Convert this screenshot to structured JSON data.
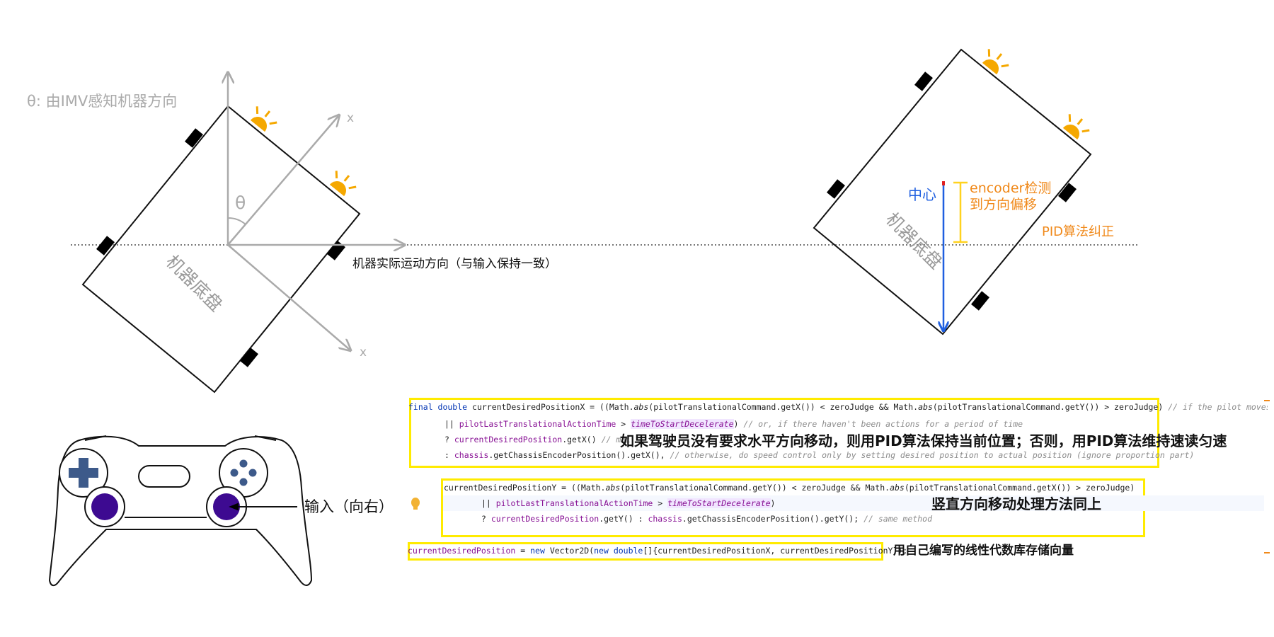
{
  "left_diagram": {
    "theta_caption": "θ: 由IMV感知机器方向",
    "axis_x_upper": "x",
    "axis_x_lower": "x",
    "theta_symbol": "θ",
    "chassis_label": "机器底盘",
    "motion_label": "机器实际运动方向（与输入保持一致）"
  },
  "right_diagram": {
    "chassis_label": "机器底盘",
    "center_label": "中心",
    "encoder_label_line1": "encoder检测",
    "encoder_label_line2": "到方向偏移",
    "pid_label": "PID算法纠正"
  },
  "gamepad": {
    "input_label": "输入（向右）"
  },
  "code": {
    "block_x": {
      "line1_a": "final double ",
      "line1_b": "currentDesiredPositionX = ((Math.",
      "line1_c": "abs",
      "line1_d": "(pilotTranslationalCommand.getX()) < zeroJudge && Math.",
      "line1_e": "abs",
      "line1_f": "(pilotTranslationalCommand.getY()) > zeroJudge) ",
      "line1_g": "// if the pilot moves the y axi",
      "line2_a": "|| ",
      "line2_b": "pilotLastTranslationalActionTime",
      "line2_c": " > ",
      "line2_d": "timeToStartDecelerate",
      "line2_e": ") ",
      "line2_f": "// or, if there haven't been actions for a period of time",
      "line3_a": "? ",
      "line3_b": "currentDesiredPosition",
      "line3_c": ".getX() ",
      "line3_d": "// mai",
      "line4_a": ": ",
      "line4_b": "chassis",
      "line4_c": ".getChassisEncoderPosition().getX(), ",
      "line4_d": "// otherwise, do speed control only by setting desired position to actual position (ignore proportion part)"
    },
    "block_y": {
      "line1_a": "currentDesiredPositionY = ((Math.",
      "line1_b": "abs",
      "line1_c": "(pilotTranslationalCommand.getY()) < zeroJudge && Math.",
      "line1_d": "abs",
      "line1_e": "(pilotTranslationalCommand.getX()) > zeroJudge)",
      "line2_a": "|| ",
      "line2_b": "pilotLastTranslationalActionTime",
      "line2_c": " > ",
      "line2_d": "timeToStartDecelerate",
      "line2_e": ")",
      "line3_a": "? ",
      "line3_b": "currentDesiredPosition",
      "line3_c": ".getY() : ",
      "line3_d": "chassis",
      "line3_e": ".getChassisEncoderPosition().getY(); ",
      "line3_f": "// same method"
    },
    "block_vec": {
      "line_a": "currentDesiredPosition",
      "line_b": " = ",
      "line_c": "new ",
      "line_d": "Vector2D(",
      "line_e": "new double",
      "line_f": "[]{currentDesiredPositionX, currentDesiredPositionY});"
    }
  },
  "annotations": {
    "note_x": "如果驾驶员没有要求水平方向移动，则用PID算法保持当前位置；否则，用PID算法维持速读匀速",
    "note_y": "竖直方向移动处理方法同上",
    "note_vec": "用自己编写的线性代数库存储向量"
  },
  "colors": {
    "axis_gray": "#aaaaaa",
    "chassis_label_gray": "#9a9a9a",
    "center_blue": "#1f5fe0",
    "encoder_orange": "#f0891a",
    "bracket_yellow": "#ffd21f",
    "sun_orange": "#f5a800",
    "highlight_yellow": "#ffeb00",
    "gamepad_blue": "#3d5a8a",
    "gamepad_purple": "#3d0a91"
  }
}
